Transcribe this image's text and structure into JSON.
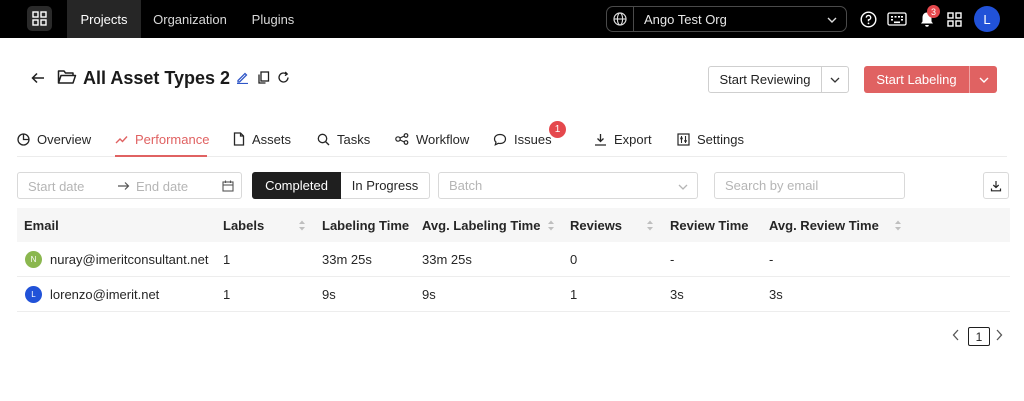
{
  "topnav": {
    "tabs": [
      {
        "label": "Projects",
        "active": true
      },
      {
        "label": "Organization",
        "active": false
      },
      {
        "label": "Plugins",
        "active": false
      }
    ],
    "org": "Ango Test Org",
    "notifications_count": "3",
    "avatar_initial": "L"
  },
  "project": {
    "title": "All Asset Types 2",
    "start_reviewing": "Start Reviewing",
    "start_labeling": "Start Labeling",
    "accent_color": "#e06262"
  },
  "tabs": [
    {
      "label": "Overview",
      "icon": "pie-chart-icon"
    },
    {
      "label": "Performance",
      "icon": "line-chart-icon",
      "active": true
    },
    {
      "label": "Assets",
      "icon": "file-icon"
    },
    {
      "label": "Tasks",
      "icon": "search-icon"
    },
    {
      "label": "Workflow",
      "icon": "workflow-icon"
    },
    {
      "label": "Issues",
      "icon": "comment-icon",
      "badge": "1"
    },
    {
      "label": "Export",
      "icon": "download-icon"
    },
    {
      "label": "Settings",
      "icon": "sliders-icon"
    }
  ],
  "filters": {
    "start_date_placeholder": "Start date",
    "end_date_placeholder": "End date",
    "status_options": [
      "Completed",
      "In Progress"
    ],
    "status_selected": "Completed",
    "batch_placeholder": "Batch",
    "email_placeholder": "Search by email"
  },
  "table": {
    "headers": [
      "Email",
      "Labels",
      "Labeling Time",
      "Avg. Labeling Time",
      "Reviews",
      "Review Time",
      "Avg. Review Time"
    ],
    "rows": [
      {
        "initial": "N",
        "avatar_color": "#8bb74f",
        "email": "nuray@imeritconsultant.net",
        "labels": "1",
        "labeling_time": "33m 25s",
        "avg_labeling_time": "33m 25s",
        "reviews": "0",
        "review_time": "-",
        "avg_review_time": "-"
      },
      {
        "initial": "L",
        "avatar_color": "#2152d8",
        "email": "lorenzo@imerit.net",
        "labels": "1",
        "labeling_time": "9s",
        "avg_labeling_time": "9s",
        "reviews": "1",
        "review_time": "3s",
        "avg_review_time": "3s"
      }
    ]
  },
  "pagination": {
    "current": "1"
  }
}
